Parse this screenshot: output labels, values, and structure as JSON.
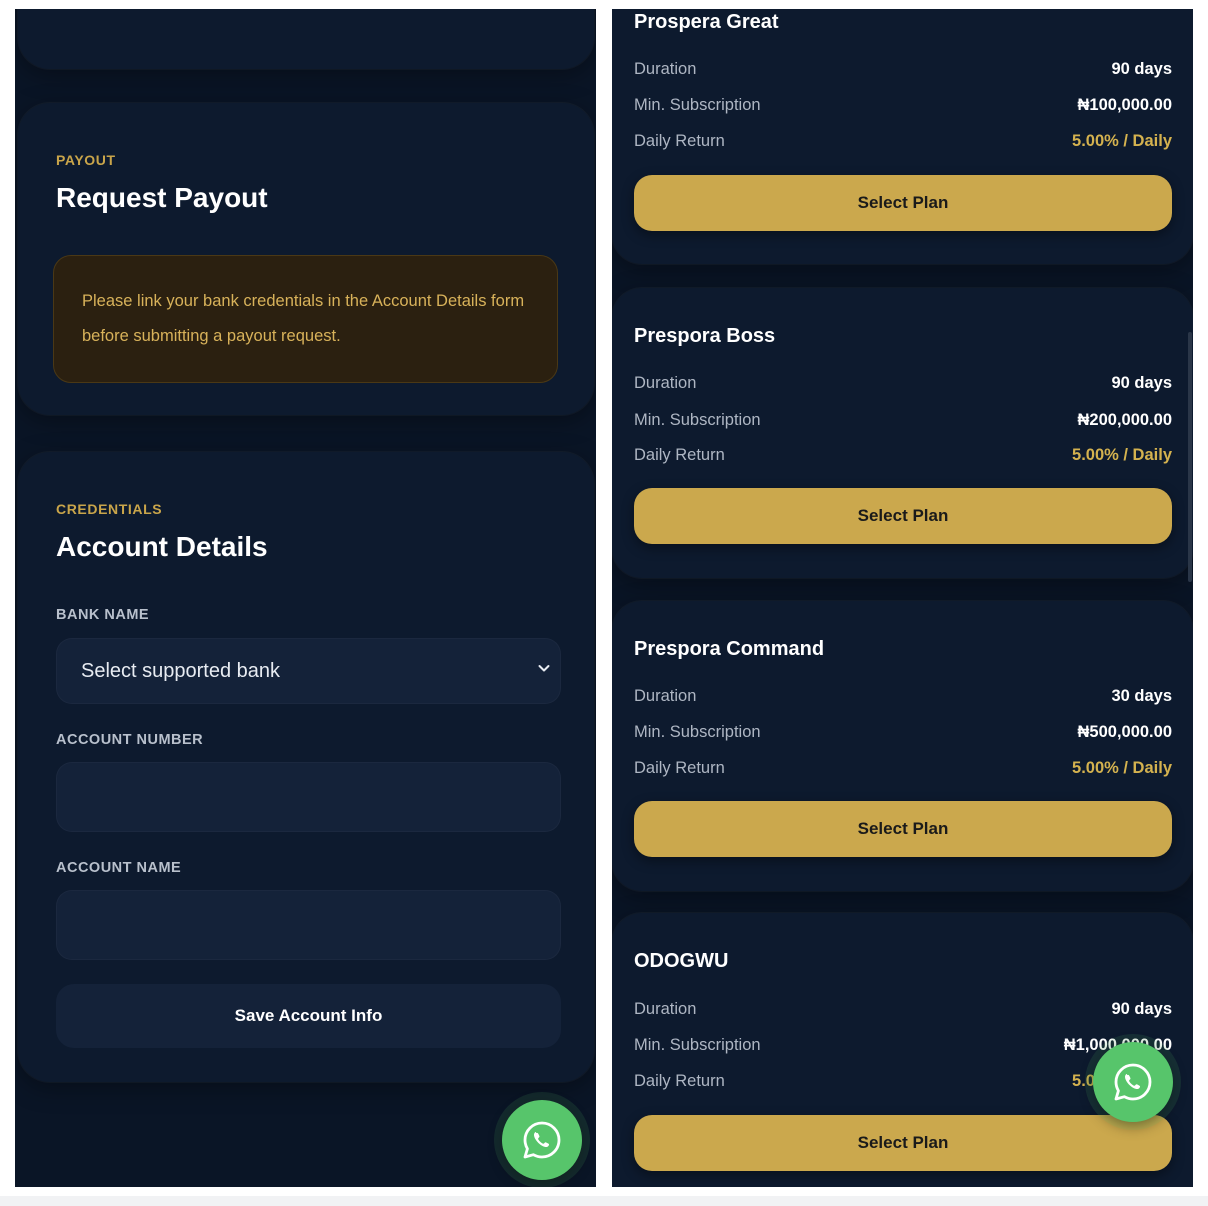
{
  "payout": {
    "eyebrow": "PAYOUT",
    "title": "Request Payout",
    "notice": "Please link your bank credentials in the Account Details form before submitting a payout request."
  },
  "credentials": {
    "eyebrow": "CREDENTIALS",
    "title": "Account Details",
    "bank_label": "BANK NAME",
    "bank_select_value": "Select supported bank",
    "account_number_label": "ACCOUNT NUMBER",
    "account_number_value": "",
    "account_name_label": "ACCOUNT NAME",
    "account_name_value": "",
    "save_button": "Save Account Info"
  },
  "plans": [
    {
      "name": "Prospera Great",
      "duration_label": "Duration",
      "duration": "90 days",
      "min_label": "Min. Subscription",
      "min": "₦100,000.00",
      "return_label": "Daily Return",
      "return": "5.00% / Daily",
      "button": "Select Plan"
    },
    {
      "name": "Prespora Boss",
      "duration_label": "Duration",
      "duration": "90 days",
      "min_label": "Min. Subscription",
      "min": "₦200,000.00",
      "return_label": "Daily Return",
      "return": "5.00% / Daily",
      "button": "Select Plan"
    },
    {
      "name": "Prespora Command",
      "duration_label": "Duration",
      "duration": "30 days",
      "min_label": "Min. Subscription",
      "min": "₦500,000.00",
      "return_label": "Daily Return",
      "return": "5.00% / Daily",
      "button": "Select Plan"
    },
    {
      "name": "ODOGWU",
      "duration_label": "Duration",
      "duration": "90 days",
      "min_label": "Min. Subscription",
      "min": "₦1,000,000.00",
      "return_label": "Daily Return",
      "return": "5.00% / Daily",
      "button": "Select Plan"
    }
  ],
  "icons": {
    "whatsapp": "whatsapp-icon",
    "chevron": "chevron-down-icon"
  },
  "colors": {
    "background": "#0a1526",
    "card": "#0d1a2e",
    "accent_gold": "#cba84d",
    "whatsapp_green": "#57c56b"
  }
}
